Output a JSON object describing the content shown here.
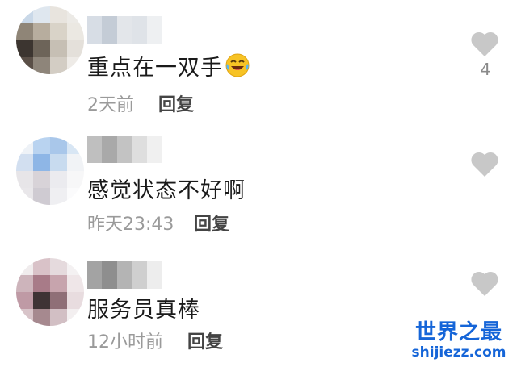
{
  "comments": [
    {
      "text": "重点在一双手",
      "time": "2天前",
      "reply_label": "回复",
      "like_count": "4",
      "emoji": "laughing-crying-emoji"
    },
    {
      "text": "感觉状态不好啊",
      "time": "昨天23:43",
      "reply_label": "回复",
      "like_count": ""
    },
    {
      "text": "服务员真棒",
      "time": "12小时前",
      "reply_label": "回复",
      "like_count": ""
    }
  ],
  "watermark": {
    "title": "世界之最",
    "url": "shijiezz.com"
  },
  "colors": {
    "watermark": "#1565d8",
    "heart": "#c8c8c8",
    "meta": "#9a9a9a"
  },
  "icons": {
    "like": "heart-icon"
  }
}
